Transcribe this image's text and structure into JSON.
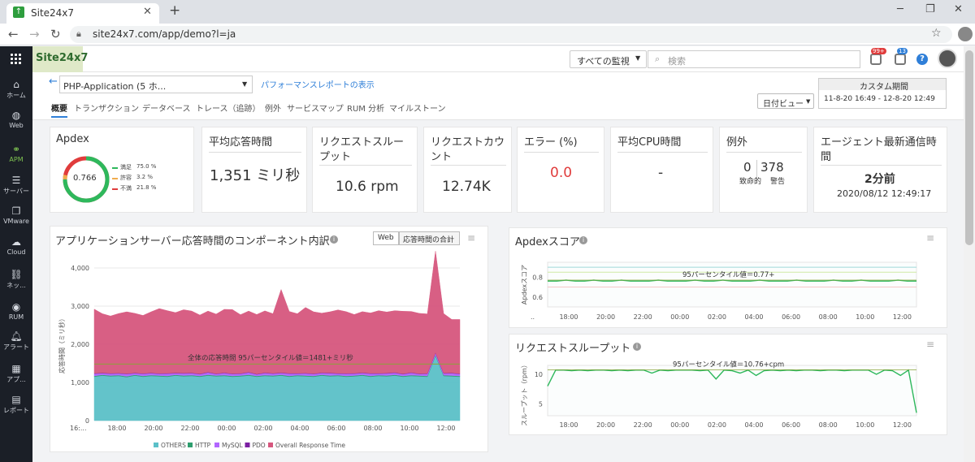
{
  "browser": {
    "tab_title": "Site24x7",
    "url": "site24x7.com/app/demo?l=ja"
  },
  "app": {
    "logo": "Site24x7",
    "monitor_filter": "すべての監視",
    "search_placeholder": "検索",
    "notif_badge_1": "99+",
    "notif_badge_2": "13"
  },
  "nav": {
    "items": [
      {
        "label": "ホーム",
        "icon": "home-icon"
      },
      {
        "label": "Web",
        "icon": "globe-icon"
      },
      {
        "label": "APM",
        "icon": "apm-icon"
      },
      {
        "label": "サーバー",
        "icon": "server-icon"
      },
      {
        "label": "VMware",
        "icon": "vmware-icon"
      },
      {
        "label": "Cloud",
        "icon": "cloud-icon"
      },
      {
        "label": "ネッ...",
        "icon": "network-icon"
      },
      {
        "label": "RUM",
        "icon": "rum-icon"
      },
      {
        "label": "アラート",
        "icon": "bell-icon"
      },
      {
        "label": "アプ...",
        "icon": "app-icon"
      },
      {
        "label": "レポート",
        "icon": "report-icon"
      }
    ]
  },
  "header": {
    "monitor_select": "PHP-Application (5 ホ...",
    "performance_link": "パフォーマンスレポートの表示",
    "date_view": "日付ビュー",
    "custom_period_title": "カスタム期間",
    "custom_period_range": "11-8-20 16:49 - 12-8-20 12:49",
    "tabs": [
      "概要",
      "トランザクション",
      "データベース",
      "トレース（追跡）",
      "例外",
      "サービスマップ",
      "RUM 分析",
      "マイルストーン"
    ]
  },
  "metrics": {
    "apdex": {
      "title": "Apdex",
      "score": "0.766",
      "legend": [
        {
          "label": "満足",
          "value": "75.0 %",
          "color": "#2eb85c"
        },
        {
          "label": "許容",
          "value": "3.2 %",
          "color": "#f0ad4e"
        },
        {
          "label": "不満",
          "value": "21.8 %",
          "color": "#e03c3c"
        }
      ]
    },
    "avg_response": {
      "title": "平均応答時間",
      "value": "1,351 ミリ秒"
    },
    "throughput": {
      "title_line1": "リクエストスルー",
      "title_line2": "プット",
      "value": "10.6 rpm"
    },
    "request_count": {
      "title_line1": "リクエストカウ",
      "title_line2": "ント",
      "value": "12.74K"
    },
    "errors": {
      "title": "エラー (%)",
      "value": "0.0"
    },
    "avg_cpu": {
      "title": "平均CPU時間",
      "value": "-"
    },
    "exceptions": {
      "title": "例外",
      "fatal_value": "0",
      "fatal_label": "致命的",
      "warn_value": "378",
      "warn_label": "警告"
    },
    "agent": {
      "title_line1": "エージェント最新通信時",
      "title_line2": "間",
      "value": "2分前",
      "timestamp": "2020/08/12 12:49:17"
    }
  },
  "charts_text": {
    "breakdown_title": "アプリケーションサーバー応答時間のコンポーネント内訳",
    "toggle_web": "Web",
    "toggle_total": "応答時間の合計",
    "breakdown_ylabel": "応答時間（ミリ秒）",
    "breakdown_annotation": "全体の応答時間 95パーセンタイル値＝1481+ミリ秒",
    "apdex_title": "Apdexスコア",
    "apdex_ylabel": "Apdexスコア",
    "apdex_annotation": "95パーセンタイル値＝0.77+",
    "throughput_title": "リクエストスループット",
    "throughput_ylabel": "スループット（rpm）",
    "throughput_annotation": "95パーセンタイル値＝10.76+cpm"
  },
  "chart_data": [
    {
      "type": "area",
      "title": "アプリケーションサーバー応答時間のコンポーネント内訳",
      "ylabel": "応答時間（ミリ秒）",
      "ylim": [
        0,
        4000
      ],
      "yticks": [
        "0",
        "1,000",
        "2,000",
        "3,000",
        "4,000"
      ],
      "xticks": [
        "16:...",
        "18:00",
        "20:00",
        "22:00",
        "00:00",
        "02:00",
        "04:00",
        "06:00",
        "08:00",
        "10:00",
        "12:00"
      ],
      "legend_placement": "bottom",
      "series": [
        {
          "name": "OTHERS",
          "color": "#5bc0c8",
          "values": [
            1150,
            1180,
            1160,
            1170,
            1140,
            1180,
            1150,
            1170,
            1160,
            1150,
            1180,
            1160,
            1170,
            1150,
            1180,
            1160,
            1170,
            1150,
            1160,
            1180,
            1150,
            1170,
            1160,
            1180,
            1150,
            1170,
            1160,
            1150,
            1180,
            1160,
            1170,
            1150,
            1160,
            1180,
            1150,
            1170,
            1160,
            1180,
            1150,
            1170,
            1160,
            1150,
            1700,
            1170,
            1160,
            1150
          ]
        },
        {
          "name": "HTTP",
          "color": "#2e9e6e",
          "values": [
            20,
            20,
            20,
            20,
            20,
            20,
            20,
            20,
            20,
            20,
            20,
            20,
            20,
            20,
            20,
            20,
            20,
            20,
            20,
            20,
            20,
            20,
            20,
            20,
            20,
            20,
            20,
            20,
            20,
            20,
            20,
            20,
            20,
            20,
            20,
            20,
            20,
            20,
            20,
            20,
            20,
            20,
            20,
            20,
            20,
            20
          ]
        },
        {
          "name": "MySQL",
          "color": "#b266ff",
          "values": [
            60,
            40,
            50,
            45,
            60,
            40,
            55,
            50,
            45,
            60,
            40,
            55,
            50,
            45,
            60,
            40,
            55,
            50,
            45,
            60,
            40,
            55,
            50,
            45,
            60,
            40,
            55,
            50,
            45,
            60,
            40,
            55,
            50,
            45,
            60,
            40,
            55,
            50,
            45,
            60,
            40,
            55,
            50,
            45,
            60,
            50
          ]
        },
        {
          "name": "PDO",
          "color": "#7b1fa2",
          "values": [
            10,
            10,
            10,
            10,
            10,
            10,
            10,
            10,
            10,
            10,
            10,
            10,
            10,
            10,
            10,
            10,
            10,
            10,
            10,
            10,
            10,
            10,
            10,
            10,
            10,
            10,
            10,
            10,
            10,
            10,
            10,
            10,
            10,
            10,
            10,
            10,
            10,
            10,
            10,
            10,
            10,
            10,
            10,
            10,
            10,
            10
          ]
        },
        {
          "name": "Overall Response Time",
          "color": "#d6577e",
          "values": [
            1680,
            1550,
            1500,
            1560,
            1620,
            1560,
            1520,
            1600,
            1700,
            1640,
            1580,
            1660,
            1620,
            1540,
            1600,
            1560,
            1660,
            1680,
            1540,
            1600,
            1560,
            1620,
            1560,
            2180,
            1620,
            1560,
            1720,
            1620,
            1560,
            1600,
            1660,
            1620,
            1540,
            1600,
            1580,
            1640,
            1600,
            1620,
            1640,
            1600,
            1580,
            1560,
            2660,
            1560,
            1400,
            1420
          ]
        }
      ],
      "annotation": "全体の応答時間 95パーセンタイル値＝1481+ミリ秒"
    },
    {
      "type": "line",
      "title": "Apdexスコア",
      "ylabel": "Apdexスコア",
      "ylim": [
        0.5,
        0.95
      ],
      "yticks": [
        "0.6",
        "0.8"
      ],
      "xticks": [
        "..",
        "18:00",
        "20:00",
        "22:00",
        "00:00",
        "02:00",
        "04:00",
        "06:00",
        "08:00",
        "10:00",
        "12:00"
      ],
      "series": [
        {
          "color": "#2eb85c",
          "values": [
            0.76,
            0.76,
            0.77,
            0.76,
            0.76,
            0.77,
            0.76,
            0.76,
            0.77,
            0.76,
            0.76,
            0.76,
            0.77,
            0.76,
            0.76,
            0.76,
            0.77,
            0.76,
            0.76,
            0.77,
            0.76,
            0.76,
            0.76,
            0.77,
            0.76,
            0.76,
            0.76,
            0.77,
            0.76,
            0.76,
            0.76,
            0.77,
            0.76,
            0.76,
            0.77,
            0.76,
            0.76,
            0.76,
            0.77,
            0.76,
            0.76
          ]
        }
      ],
      "annotation": "95パーセンタイル値＝0.77+"
    },
    {
      "type": "line",
      "title": "リクエストスループット",
      "ylabel": "スループット（rpm）",
      "ylim": [
        3,
        11.5
      ],
      "yticks": [
        "5",
        "10"
      ],
      "xticks": [
        "18:00",
        "20:00",
        "22:00",
        "00:00",
        "02:00",
        "04:00",
        "06:00",
        "08:00",
        "10:00",
        "12:00"
      ],
      "series": [
        {
          "color": "#2eb85c",
          "values": [
            8,
            10.7,
            10.7,
            10.6,
            10.7,
            10.6,
            10.7,
            10.7,
            10.6,
            10.7,
            10.6,
            10.7,
            10.7,
            10.2,
            10.7,
            10.6,
            10.7,
            10.7,
            10.7,
            10.6,
            10.7,
            9.2,
            10.7,
            10.6,
            10.2,
            10.7,
            9.8,
            10.6,
            10.7,
            10.6,
            10.7,
            10.6,
            10.7,
            10.7,
            10.6,
            10.7,
            10.7,
            10.6,
            10.7,
            10.7,
            10.7,
            10.0,
            10.7,
            10.6,
            9.8,
            10.7,
            3.5
          ]
        }
      ],
      "annotation": "95パーセンタイル値＝10.76+cpm"
    }
  ]
}
